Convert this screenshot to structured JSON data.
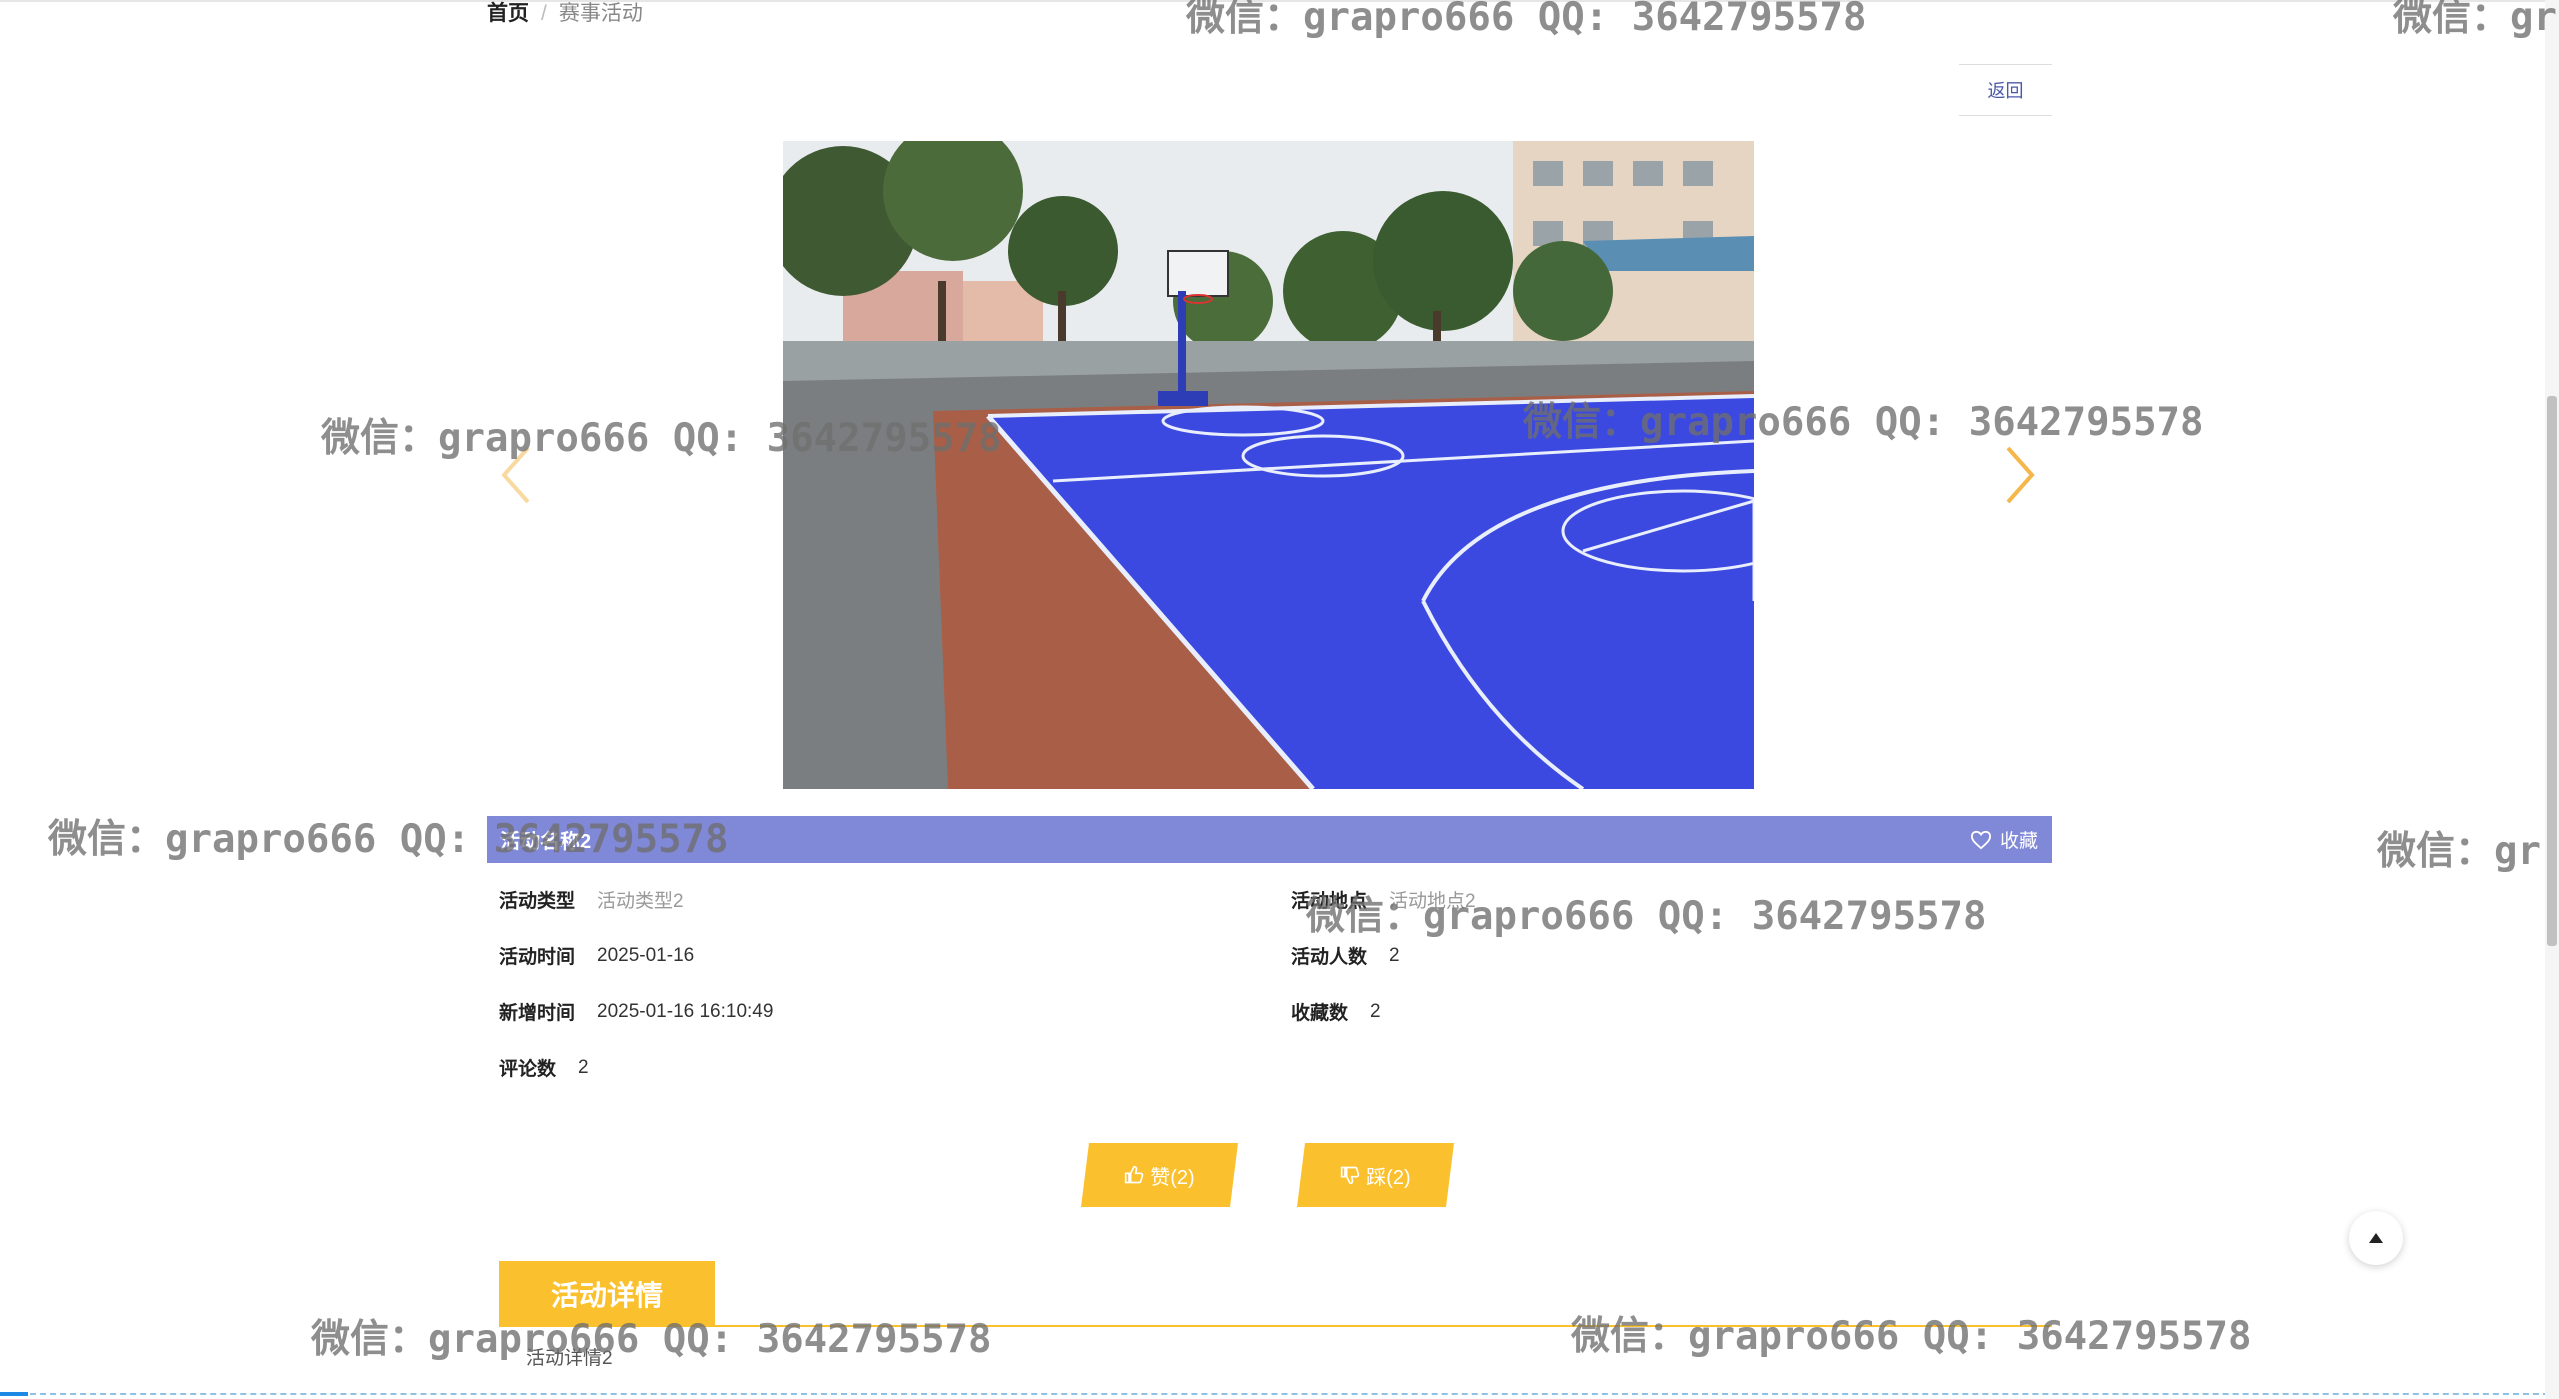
{
  "breadcrumb": {
    "home": "首页",
    "separator": "/",
    "current": "赛事活动"
  },
  "back_label": "返回",
  "carousel": {
    "prev_icon": "chevron-left-icon",
    "next_icon": "chevron-right-icon",
    "arrow_color": "#f5b74a"
  },
  "activity": {
    "name": "活动名称2",
    "favorite_label": "收藏",
    "fields": {
      "type": {
        "label": "活动类型",
        "value": "活动类型2"
      },
      "location": {
        "label": "活动地点",
        "value": "活动地点2"
      },
      "time": {
        "label": "活动时间",
        "value": "2025-01-16"
      },
      "people": {
        "label": "活动人数",
        "value": "2"
      },
      "created": {
        "label": "新增时间",
        "value": "2025-01-16 16:10:49"
      },
      "favorites": {
        "label": "收藏数",
        "value": "2"
      },
      "comments": {
        "label": "评论数",
        "value": "2"
      }
    }
  },
  "votes": {
    "like_label": "赞(2)",
    "dislike_label": "踩(2)"
  },
  "detail": {
    "tab_label": "活动详情",
    "content": "活动详情2"
  },
  "watermark_text": "微信：grapro666 QQ: 3642795578",
  "watermark_partial": "微信：gr",
  "colors": {
    "title_bar": "#8088d8",
    "accent": "#fbc02d",
    "back_text": "#4b5aa8"
  }
}
